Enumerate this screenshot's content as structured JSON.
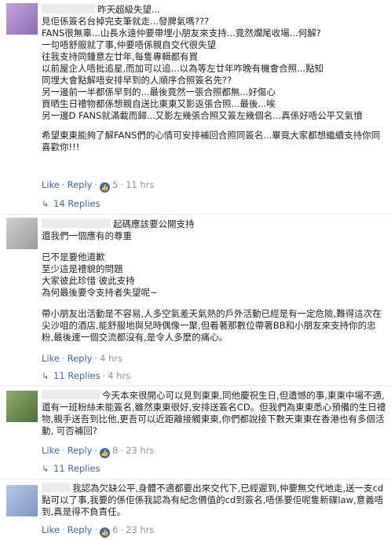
{
  "comments": [
    {
      "first_line": "昨天超級失望...",
      "lines": [
        "見佢係簽名台掉完支筆就走...發脾氣嗎???",
        "FANS很無辜...山長水遠仲要帶埋小朋友來支持...竟然爛尾收場...何解?",
        "一句唔舒服就了事,仲要唔係親自交代很失望",
        "往我支持同鍾意左廿年,每隻專輯都有買",
        "以前屋企人唔批追星,而加可以追...以為等左廿年咋晚有機會合照...點知",
        "同埋大會點解唔安排早到的人順序合照簽名先??",
        "另一邊前一半都係早到的...最後竟然一張合照都無...好傷心",
        "買晒生日禮物都係想親自送比東東又影返張合照...最後...唉",
        "另一邊D FANS就滿載而歸...又影左幾張合照又簽左幾個名...真係好唔公平又氣憤"
      ],
      "closing": "希望東東能夠了解FANS們的心情可安排補回合照同簽名...畢竟大家都想繼續支持你同喜歡你!!!",
      "like": "Like",
      "reply": "Reply",
      "likes": "5",
      "time": "11 hrs",
      "replies": "14 Replies"
    },
    {
      "first_line": "起碼應該要公開支持",
      "lines": [
        "還我們一個應有的尊重",
        "",
        "已不是要他道歉",
        "至少這是禮貌的問題",
        "大家彼此珍惜 彼此支持",
        "為何最後要令支持者失望呢~"
      ],
      "closing": "帶小朋友出活動是不容易,人多空氣差天氣熱的戶外活動已經是有一定危險,難得這次在尖沙咀的酒店,能舒服地與兒時偶像一聚,但看著那數位帶著BB和小朋友來支持你的忠粉,最後連一個交流都沒有,是令人多麼的痛心。",
      "like": "Like",
      "reply": "Reply",
      "time": "4 hrs",
      "replies": "11 Replies"
    },
    {
      "first_line": "今天本來很開心可以見到東東,同他慶祝生日,但遺憾的事,東東中場不適,還有一班粉絲未能簽名,雖然東東很好,安排送簽名CD。但我們為東東悉心預備的生日禮物,親手送吾到比他,更吾可以近距離接觸東東,你們都說接下數天東東在香港也有多個活動, 可否補回?",
      "like": "Like",
      "reply": "Reply",
      "likes": "8",
      "time": "23 hrs",
      "replies": "11 Replies"
    },
    {
      "first_line": "我認為欠缺公平,身體不適都要出來交代下,已經遲到,仲要無交代地走,送一支cd點可以了事,我要的係佢係我認為有紀念價值的cd到簽名,唔係要佢呢隻新碟law,意義唔到,真是得不負責任。",
      "like": "Like",
      "reply": "Reply",
      "likes": "6",
      "time": "23 hrs"
    }
  ],
  "icons": {
    "like_icon": "thumbs-up-icon",
    "reply_arrow": "reply-arrow-icon"
  },
  "colors": {
    "link": "#4267b2",
    "meta": "#90949c",
    "text": "#1d2129"
  }
}
